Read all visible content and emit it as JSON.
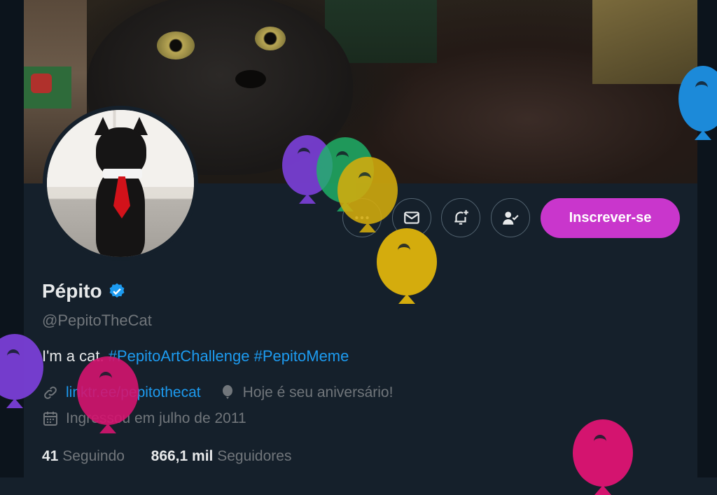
{
  "profile": {
    "display_name": "Pépito",
    "handle": "@PepitoTheCat",
    "bio_text": "I'm a cat.",
    "bio_hashtags": [
      "#PepitoArtChallenge",
      "#PepitoMeme"
    ],
    "link": "linktr.ee/pepitothecat",
    "birthday_text": "Hoje é seu aniversário!",
    "joined_text": "Ingressou em julho de 2011",
    "following_count": "41",
    "following_label": "Seguindo",
    "followers_count": "866,1 mil",
    "followers_label": "Seguidores"
  },
  "actions": {
    "more_icon": "more-icon",
    "message_icon": "mail-icon",
    "notify_icon": "bell-plus-icon",
    "follow_status_icon": "user-check-icon",
    "subscribe_label": "Inscrever-se"
  },
  "colors": {
    "background": "#15202b",
    "accent_link": "#1d9bf0",
    "subscribe": "#c936cc",
    "verified": "#1d9bf0",
    "balloon_purple": "#7a3fd6",
    "balloon_green": "#1fb46a",
    "balloon_yellow": "#d4ac0d",
    "balloon_blue": "#1c8ad9",
    "balloon_pink": "#d4146f"
  }
}
